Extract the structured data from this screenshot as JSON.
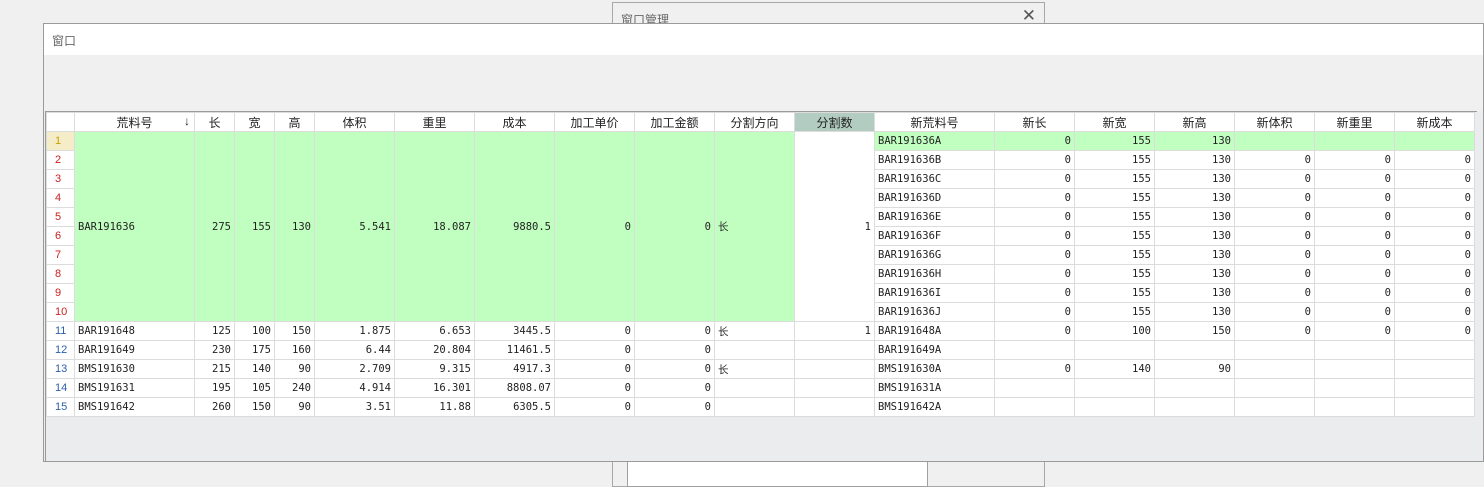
{
  "background_window": {
    "title": "窗口管理",
    "close_glyph": "✕"
  },
  "main_window": {
    "title": "窗口"
  },
  "grid": {
    "sort_indicator": "↓",
    "columns": [
      "荒料号",
      "长",
      "宽",
      "高",
      "体积",
      "重里",
      "成本",
      "加工单价",
      "加工金额",
      "分割方向",
      "分割数",
      "新荒料号",
      "新长",
      "新宽",
      "新高",
      "新体积",
      "新重里",
      "新成本"
    ],
    "merged_group": {
      "rows": 10,
      "values": [
        "BAR191636",
        "275",
        "155",
        "130",
        "5.541",
        "18.087",
        "9880.5",
        "0",
        "0",
        "长",
        "1"
      ],
      "row_numbers": [
        "1",
        "2",
        "3",
        "4",
        "5",
        "6",
        "7",
        "8",
        "9",
        "10"
      ],
      "new_rows": [
        [
          "BAR191636A",
          "0",
          "155",
          "130",
          "",
          "",
          ""
        ],
        [
          "BAR191636B",
          "0",
          "155",
          "130",
          "0",
          "0",
          "0"
        ],
        [
          "BAR191636C",
          "0",
          "155",
          "130",
          "0",
          "0",
          "0"
        ],
        [
          "BAR191636D",
          "0",
          "155",
          "130",
          "0",
          "0",
          "0"
        ],
        [
          "BAR191636E",
          "0",
          "155",
          "130",
          "0",
          "0",
          "0"
        ],
        [
          "BAR191636F",
          "0",
          "155",
          "130",
          "0",
          "0",
          "0"
        ],
        [
          "BAR191636G",
          "0",
          "155",
          "130",
          "0",
          "0",
          "0"
        ],
        [
          "BAR191636H",
          "0",
          "155",
          "130",
          "0",
          "0",
          "0"
        ],
        [
          "BAR191636I",
          "0",
          "155",
          "130",
          "0",
          "0",
          "0"
        ],
        [
          "BAR191636J",
          "0",
          "155",
          "130",
          "0",
          "0",
          "0"
        ]
      ]
    },
    "rows": [
      {
        "n": "11",
        "cells": [
          "BAR191648",
          "125",
          "100",
          "150",
          "1.875",
          "6.653",
          "3445.5",
          "0",
          "0",
          "长",
          "1",
          "BAR191648A",
          "0",
          "100",
          "150",
          "0",
          "0",
          "0"
        ]
      },
      {
        "n": "12",
        "cells": [
          "BAR191649",
          "230",
          "175",
          "160",
          "6.44",
          "20.804",
          "11461.5",
          "0",
          "0",
          "",
          "",
          "BAR191649A",
          "",
          "",
          "",
          "",
          "",
          ""
        ]
      },
      {
        "n": "13",
        "cells": [
          "BMS191630",
          "215",
          "140",
          "90",
          "2.709",
          "9.315",
          "4917.3",
          "0",
          "0",
          "长",
          "",
          "BMS191630A",
          "0",
          "140",
          "90",
          "",
          "",
          ""
        ]
      },
      {
        "n": "14",
        "cells": [
          "BMS191631",
          "195",
          "105",
          "240",
          "4.914",
          "16.301",
          "8808.07",
          "0",
          "0",
          "",
          "",
          "BMS191631A",
          "",
          "",
          "",
          "",
          "",
          ""
        ]
      },
      {
        "n": "15",
        "cells": [
          "BMS191642",
          "260",
          "150",
          "90",
          "3.51",
          "11.88",
          "6305.5",
          "0",
          "0",
          "",
          "",
          "BMS191642A",
          "",
          "",
          "",
          "",
          "",
          ""
        ]
      }
    ]
  },
  "colors": {
    "selected_row_bg": "#c1ffc1",
    "selected_column_header_bg": "#b3ccc2",
    "merged_row_number_color": "#cc1f1f",
    "row_number_color": "#2b5fa8"
  }
}
